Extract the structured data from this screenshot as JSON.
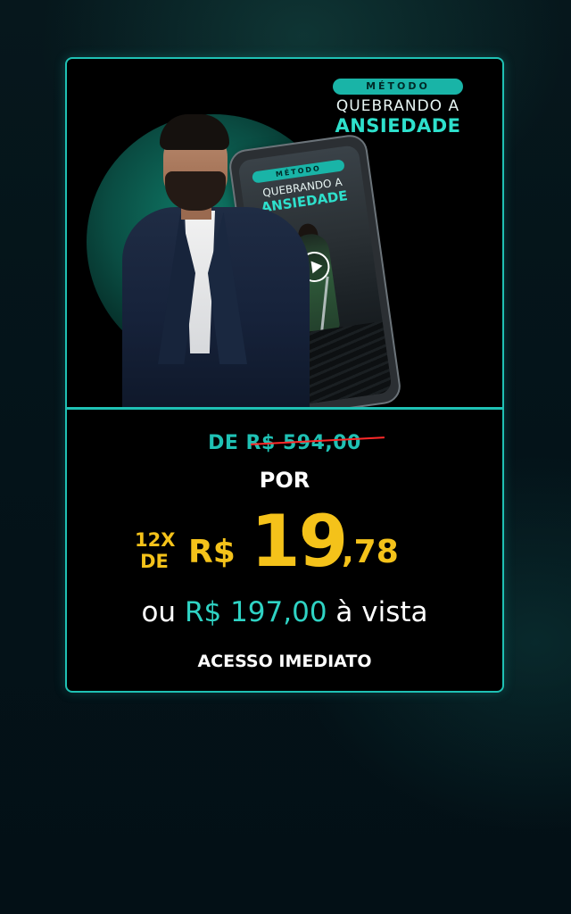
{
  "logo": {
    "badge": "MÉTODO",
    "line2": "QUEBRANDO A",
    "line3": "ANSIEDADE"
  },
  "phone_screen": {
    "badge": "MÉTODO",
    "line2": "QUEBRANDO A",
    "line3": "ANSIEDADE",
    "play_icon": "play-icon"
  },
  "pricing": {
    "old_price": "DE R$ 594,00",
    "por": "POR",
    "installments_count": "12X",
    "installments_de": "DE",
    "currency": "R$",
    "value_integer": "19",
    "value_cents": ",78",
    "cash_prefix": "ou",
    "cash_value": "R$ 197,00",
    "cash_suffix": "à vista",
    "access": "ACESSO IMEDIATO"
  },
  "colors": {
    "accent": "#1fc1b4",
    "price": "#f4c21a",
    "strike": "#ff2a2a"
  }
}
